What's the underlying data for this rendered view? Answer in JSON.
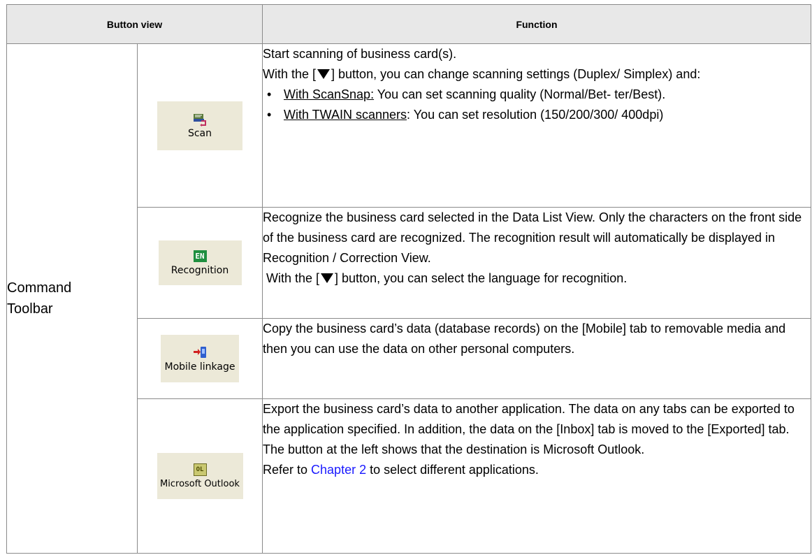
{
  "table": {
    "header": {
      "button_view": "Button view",
      "function": "Function"
    },
    "group_label": "Command\nToolbar",
    "rows": [
      {
        "button": {
          "label": "Scan",
          "icon": "scan-icon"
        },
        "function": {
          "line1": "Start scanning of business card(s).",
          "line2_pre": "With the [",
          "line2_post": "] button, you can change scanning settings (Duplex/ Simplex) and:",
          "bullet1_link": "With ScanSnap:",
          "bullet1_text": " You can set scanning quality (Normal/Bet- ter/Best).",
          "bullet2_link": "With TWAIN scanners",
          "bullet2_text": ": You can set resolution (150/200/300/ 400dpi)"
        }
      },
      {
        "button": {
          "label": "Recognition",
          "icon": "en-recognition-icon",
          "icon_text": "EN"
        },
        "function": {
          "para": "Recognize the business card selected in the Data List View. Only the characters on the front side of the business card are recognized. The recognition result will automatically be displayed in Recognition / Correction View.",
          "line2_pre": " With the [",
          "line2_post": "] button, you can select the language for recognition."
        }
      },
      {
        "button": {
          "label": "Mobile linkage",
          "icon": "mobile-linkage-icon"
        },
        "function": {
          "para": "Copy the business card’s data (database records) on the [Mobile] tab to removable media and then you can use the data on other personal computers."
        }
      },
      {
        "button": {
          "label": "Microsoft Outlook",
          "icon": "outlook-icon",
          "icon_text": "OL"
        },
        "function": {
          "para": "Export the business card’s data to another application. The data on any tabs can be exported to the application specified. In addition, the data on the [Inbox] tab is moved to the [Exported] tab.",
          "line2": "The button at the left shows that the destination is Microsoft Outlook.",
          "line3_pre": "Refer to ",
          "line3_link": "Chapter 2",
          "line3_post": " to select different applications."
        }
      }
    ]
  },
  "colors": {
    "header_bg": "#e8e8e8",
    "button_bg": "#ece9d8",
    "link": "#1a1aff",
    "border": "#8a8a8a"
  }
}
